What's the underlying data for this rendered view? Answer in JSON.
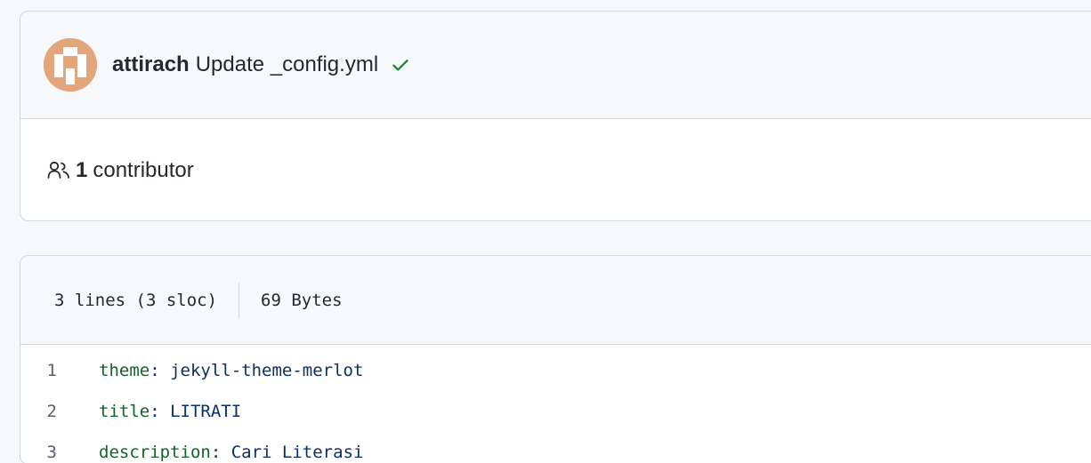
{
  "commit": {
    "author": "attirach",
    "message": "Update _config.yml",
    "status_icon": "check-icon",
    "status_color": "#1a7f37"
  },
  "contributors": {
    "count": "1",
    "label": "contributor",
    "icon": "people-icon"
  },
  "file": {
    "lines_info": "3 lines (3 sloc)",
    "size": "69 Bytes"
  },
  "code": {
    "lines": [
      {
        "num": "1",
        "key": "theme",
        "value": "jekyll-theme-merlot"
      },
      {
        "num": "2",
        "key": "title",
        "value": "LITRATI"
      },
      {
        "num": "3",
        "key": "description",
        "value": "Cari Literasi"
      }
    ]
  }
}
